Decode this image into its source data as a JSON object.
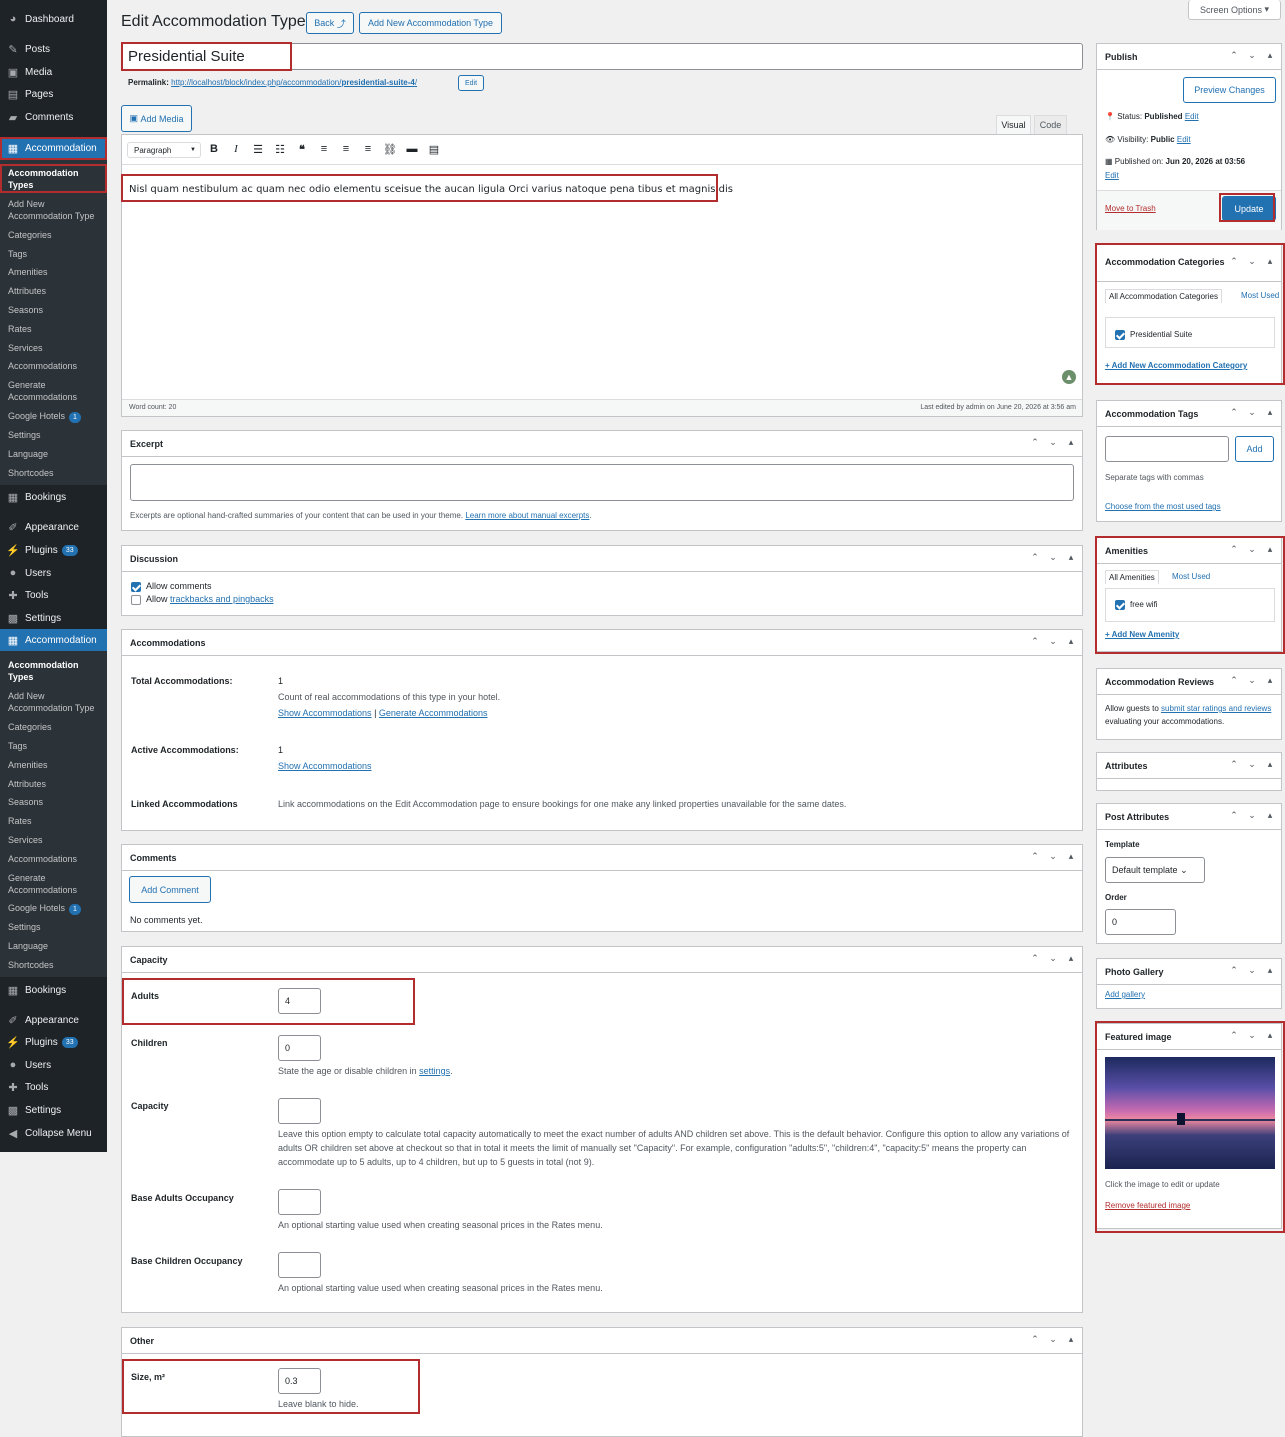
{
  "menu": {
    "top_items": [
      {
        "label": "Dashboard",
        "icon": "dashboard-icon"
      },
      {
        "label": "Posts",
        "icon": "pin-icon"
      },
      {
        "label": "Media",
        "icon": "media-icon"
      },
      {
        "label": "Pages",
        "icon": "page-icon"
      },
      {
        "label": "Comments",
        "icon": "comment-icon"
      },
      {
        "label": "Accommodation",
        "icon": "building-icon"
      }
    ],
    "sub_items": [
      "Accommodation Types",
      "Add New Accommodation Type",
      "Categories",
      "Tags",
      "Amenities",
      "Attributes",
      "Seasons",
      "Rates",
      "Services",
      "Accommodations",
      "Generate Accommodations",
      "Google Hotels",
      "Settings",
      "Language",
      "Shortcodes"
    ],
    "google_badge": "1",
    "lower_items": [
      {
        "label": "Bookings",
        "icon": "calendar-icon"
      },
      {
        "label": "Appearance",
        "icon": "brush-icon"
      },
      {
        "label": "Plugins",
        "icon": "plug-icon",
        "badge": "33"
      },
      {
        "label": "Users",
        "icon": "users-icon"
      },
      {
        "label": "Tools",
        "icon": "wrench-icon"
      },
      {
        "label": "Settings",
        "icon": "settings-icon"
      },
      {
        "label": "Accommodation",
        "icon": "building-icon"
      }
    ],
    "lower2_items": [
      {
        "label": "Bookings",
        "icon": "calendar-icon"
      },
      {
        "label": "Appearance",
        "icon": "brush-icon"
      },
      {
        "label": "Plugins",
        "icon": "plug-icon",
        "badge": "33"
      },
      {
        "label": "Users",
        "icon": "users-icon"
      },
      {
        "label": "Tools",
        "icon": "wrench-icon"
      },
      {
        "label": "Settings",
        "icon": "settings-icon"
      },
      {
        "label": "Collapse Menu",
        "icon": "collapse-icon"
      }
    ]
  },
  "screen_options": "Screen Options",
  "page": {
    "heading": "Edit Accommodation Type",
    "back_label": "Back",
    "add_new_label": "Add New Accommodation Type",
    "title_value": "Presidential Suite",
    "permalink_label": "Permalink:",
    "permalink_base": "http://localhost/block/index.php/accommodation/",
    "permalink_slug": "presidential-suite-4",
    "permalink_end": "/",
    "permalink_edit": "Edit"
  },
  "editor": {
    "add_media": "Add Media",
    "tab_visual": "Visual",
    "tab_code": "Code",
    "format_select": "Paragraph",
    "content": "Nisl quam nestibulum ac quam nec odio elementu sceisue the aucan ligula Orci varius natoque pena tibus et magnis dis",
    "word_count": "Word count: 20",
    "last_edited": "Last edited by admin on June 20, 2026 at 3:56 am"
  },
  "excerpt": {
    "title": "Excerpt",
    "help": "Excerpts are optional hand-crafted summaries of your content that can be used in your theme.",
    "link": "Learn more about manual excerpts"
  },
  "discussion": {
    "title": "Discussion",
    "allow_comments": "Allow comments",
    "allow_prefix": "Allow",
    "trackbacks_link": "trackbacks and pingbacks"
  },
  "accommodations": {
    "title": "Accommodations",
    "total_label": "Total Accommodations:",
    "total_value": "1",
    "total_desc": "Count of real accommodations of this type in your hotel.",
    "show_link": "Show Accommodations",
    "sep": "|",
    "generate_link": "Generate Accommodations",
    "active_label": "Active Accommodations:",
    "active_value": "1",
    "linked_label": "Linked Accommodations",
    "linked_desc": "Link accommodations on the Edit Accommodation page to ensure bookings for one make any linked properties unavailable for the same dates."
  },
  "comments": {
    "title": "Comments",
    "add_label": "Add Comment",
    "none": "No comments yet."
  },
  "capacity": {
    "title": "Capacity",
    "adults_label": "Adults",
    "adults_value": "4",
    "children_label": "Children",
    "children_value": "0",
    "children_desc_prefix": "State the age or disable children in",
    "children_desc_link": "settings",
    "children_desc_end": ".",
    "capacity_label": "Capacity",
    "capacity_desc": "Leave this option empty to calculate total capacity automatically to meet the exact number of adults AND children set above. This is the default behavior. Configure this option to allow any variations of adults OR children set above at checkout so that in total it meets the limit of manually set \"Capacity\". For example, configuration \"adults:5\", \"children:4\", \"capacity:5\" means the property can accommodate up to 5 adults, up to 4 children, but up to 5 guests in total (not 9).",
    "base_adults_label": "Base Adults Occupancy",
    "base_adults_desc": "An optional starting value used when creating seasonal prices in the Rates menu.",
    "base_children_label": "Base Children Occupancy",
    "base_children_desc": "An optional starting value used when creating seasonal prices in the Rates menu."
  },
  "other": {
    "title": "Other",
    "size_label": "Size, m²",
    "size_value": "0.3",
    "size_desc": "Leave blank to hide."
  },
  "publish": {
    "title": "Publish",
    "preview": "Preview Changes",
    "status_label": "Status:",
    "status_value": "Published",
    "visibility_label": "Visibility:",
    "visibility_value": "Public",
    "published_label": "Published on:",
    "published_value": "Jun 20, 2026 at 03:56",
    "edit": "Edit",
    "trash": "Move to Trash",
    "update": "Update"
  },
  "categories": {
    "title": "Accommodation Categories",
    "tab_all": "All Accommodation Categories",
    "tab_most": "Most Used",
    "item": "Presidential Suite",
    "add_link": "+ Add New Accommodation Category"
  },
  "tags": {
    "title": "Accommodation Tags",
    "add": "Add",
    "help": "Separate tags with commas",
    "choose": "Choose from the most used tags"
  },
  "amenities": {
    "title": "Amenities",
    "tab_all": "All Amenities",
    "tab_most": "Most Used",
    "item": "free wifi",
    "add_link": "+ Add New Amenity"
  },
  "reviews": {
    "title": "Accommodation Reviews",
    "prefix": "Allow guests to",
    "link": "submit star ratings and reviews",
    "suffix": "evaluating your accommodations."
  },
  "attributes": {
    "title": "Attributes"
  },
  "post_attributes": {
    "title": "Post Attributes",
    "template_label": "Template",
    "template_value": "Default template",
    "order_label": "Order",
    "order_value": "0"
  },
  "gallery": {
    "title": "Photo Gallery",
    "add": "Add gallery"
  },
  "featured": {
    "title": "Featured image",
    "help": "Click the image to edit or update",
    "remove": "Remove featured image"
  },
  "colors": {
    "accent": "#2271b1",
    "highlight": "#b32d2e",
    "menu_bg": "#1d2327"
  }
}
